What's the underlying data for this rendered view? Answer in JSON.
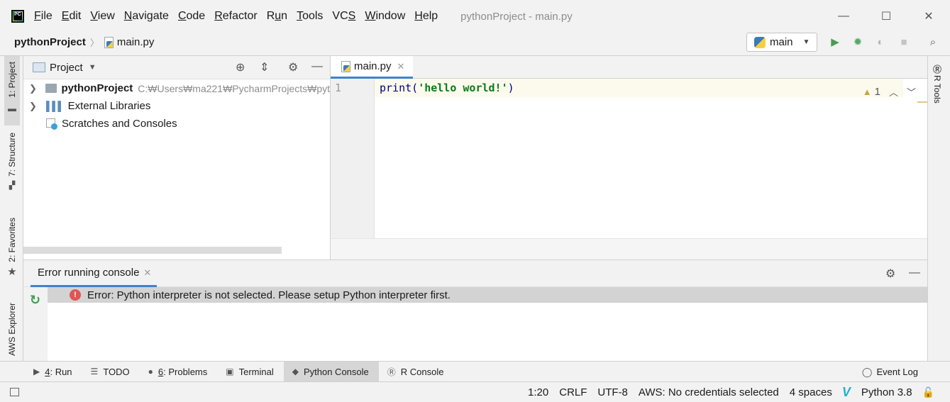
{
  "titlebar": {
    "logo_text": "PC",
    "menu": [
      {
        "mnemonic": "F",
        "rest": "ile"
      },
      {
        "mnemonic": "E",
        "rest": "dit"
      },
      {
        "mnemonic": "V",
        "rest": "iew"
      },
      {
        "mnemonic": "N",
        "rest": "avigate"
      },
      {
        "mnemonic": "C",
        "rest": "ode"
      },
      {
        "mnemonic": "R",
        "rest": "efactor"
      },
      {
        "pre": "R",
        "mnemonic": "u",
        "rest": "n"
      },
      {
        "mnemonic": "T",
        "rest": "ools"
      },
      {
        "pre": "VC",
        "mnemonic": "S",
        "rest": ""
      },
      {
        "mnemonic": "W",
        "rest": "indow"
      },
      {
        "mnemonic": "H",
        "rest": "elp"
      }
    ],
    "window_title": "pythonProject - main.py",
    "minimize": "—",
    "maximize": "☐",
    "close": "✕"
  },
  "navbar": {
    "project": "pythonProject",
    "separator": "〉",
    "file": "main.py",
    "run_config": "main"
  },
  "left_strip": {
    "project_tab": "1: Project",
    "structure_tab": "7: Structure",
    "favorites_tab": "2: Favorites",
    "aws_tab": "AWS Explorer"
  },
  "right_strip": {
    "r_tools_tab": "R Tools"
  },
  "project_panel": {
    "title": "Project",
    "tree": {
      "project_name": "pythonProject",
      "project_path": "C:₩Users₩ma221₩PycharmProjects₩pyt",
      "libraries": "External Libraries",
      "scratches": "Scratches and Consoles"
    }
  },
  "editor": {
    "tab_label": "main.py",
    "line_number": "1",
    "code_fn": "print(",
    "code_str": "'hello world!'",
    "code_end": ")",
    "warnings_count": "1"
  },
  "console": {
    "tab_label": "Error running console",
    "error_message": "Error: Python interpreter is not selected. Please setup Python interpreter first."
  },
  "bottom_tools": [
    {
      "num": "4",
      "label": ": Run",
      "icon": "▶"
    },
    {
      "num": "",
      "label": "TODO",
      "icon": "☰"
    },
    {
      "num": "6",
      "label": ": Problems",
      "icon": "●"
    },
    {
      "num": "",
      "label": "Terminal",
      "icon": "▣"
    },
    {
      "num": "",
      "label": "Python Console",
      "icon": "◆"
    },
    {
      "num": "",
      "label": "R Console",
      "icon": "Ⓡ"
    }
  ],
  "event_log": "Event Log",
  "status": {
    "position": "1:20",
    "line_sep": "CRLF",
    "encoding": "UTF-8",
    "aws": "AWS: No credentials selected",
    "indent": "4 spaces",
    "interpreter": "Python 3.8"
  },
  "colors": {
    "accent": "#4083c9",
    "run_green": "#499c54",
    "error_red": "#e05555"
  }
}
